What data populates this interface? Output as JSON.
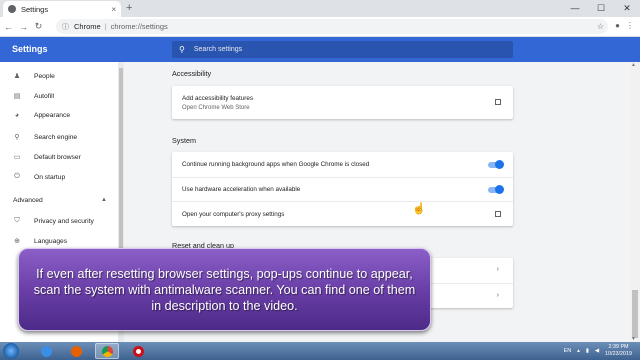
{
  "browser": {
    "tab_title": "Settings",
    "tab_close": "×",
    "new_tab": "+",
    "window_controls": [
      "—",
      "☐",
      "✕"
    ],
    "nav": [
      "←",
      "→",
      "↻"
    ],
    "address_site": "Chrome",
    "address_sep": "|",
    "address_url": "chrome://settings",
    "toolbar_icons": [
      "star-icon",
      "account-icon",
      "menu-icon"
    ]
  },
  "settings": {
    "title": "Settings",
    "search_placeholder": "Search settings"
  },
  "sidebar": {
    "items": [
      {
        "label": "People",
        "icon": "person-icon"
      },
      {
        "label": "Autofill",
        "icon": "clipboard-icon"
      },
      {
        "label": "Appearance",
        "icon": "palette-icon"
      },
      {
        "label": "Search engine",
        "icon": "search-icon"
      },
      {
        "label": "Default browser",
        "icon": "browser-icon"
      },
      {
        "label": "On startup",
        "icon": "power-icon"
      }
    ],
    "advanced_label": "Advanced",
    "advanced_items": [
      {
        "label": "Privacy and security",
        "icon": "shield-icon"
      },
      {
        "label": "Languages",
        "icon": "globe-icon"
      }
    ]
  },
  "main": {
    "accessibility": {
      "title": "Accessibility",
      "row_label": "Add accessibility features",
      "row_sub": "Open Chrome Web Store"
    },
    "system": {
      "title": "System",
      "rows": [
        {
          "label": "Continue running background apps when Google Chrome is closed",
          "control": "toggle",
          "on": true
        },
        {
          "label": "Use hardware acceleration when available",
          "control": "toggle",
          "on": true
        },
        {
          "label": "Open your computer's proxy settings",
          "control": "external-link"
        }
      ]
    },
    "reset_title": "Reset and clean up"
  },
  "overlay": {
    "text": "If even after resetting browser settings, pop-ups continue to appear, scan the system with antimalware scanner. You can find one of them in description to the video."
  },
  "taskbar": {
    "apps": [
      "windows-explorer",
      "internet-explorer",
      "firefox",
      "chrome",
      "opera"
    ],
    "language": "EN",
    "time": "2:39 PM",
    "date": "10/23/2019"
  },
  "colors": {
    "settings_header": "#3367d6",
    "toggle_on": "#1a73e8",
    "overlay_purple": "#6a3fa8"
  }
}
